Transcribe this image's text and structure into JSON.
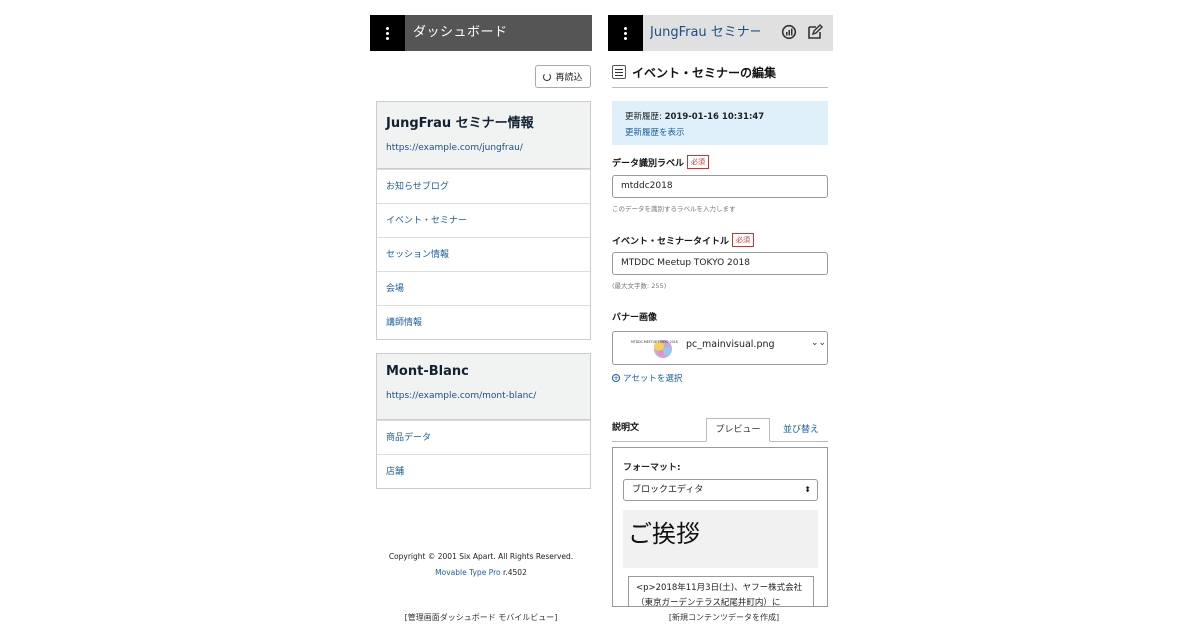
{
  "left": {
    "header_title": "ダッシュボード",
    "reload_label": "再読込",
    "sites": [
      {
        "name": "JungFrau セミナー情報",
        "url": "https://example.com/jungfrau/",
        "items": [
          "お知らせブログ",
          "イベント・セミナー",
          "セッション情報",
          "会場",
          "講師情報"
        ]
      },
      {
        "name": "Mont-Blanc",
        "url": "https://example.com/mont-blanc/",
        "items": [
          "商品データ",
          "店舗"
        ]
      }
    ],
    "footer_copyright": "Copyright © 2001 Six Apart. All Rights Reserved.",
    "footer_product": "Movable Type Pro",
    "footer_version": "r.4502",
    "caption": "[管理画面ダッシュボード モバイルビュー]"
  },
  "right": {
    "header_title": "JungFrau セミナー...",
    "page_title": "イベント・セミナーの編集",
    "history_label": "更新履歴:",
    "history_value": "2019-01-16 10:31:47",
    "history_link": "更新履歴を表示",
    "field_label1": "データ識別ラベル",
    "required_text": "必須",
    "field_value1": "mtddc2018",
    "field_hint1": "このデータを識別するラベルを入力します",
    "field_label2": "イベント・セミナータイトル",
    "field_value2": "MTDDC Meetup TOKYO 2018",
    "field_hint2": "(最大文字数: 255)",
    "banner_label": "バナー画像",
    "asset_thumb_text": "MTDDC MEETUP TOKYO 2018",
    "asset_filename": "pc_mainvisual.png",
    "select_asset": "アセットを選択",
    "desc_label": "説明文",
    "tab_preview": "プレビュー",
    "tab_sort": "並び替え",
    "format_label": "フォーマット:",
    "format_value": "ブロックエディタ",
    "heading_text": "ご挨拶",
    "html_content": "<p>2018年11月3日(土)、ヤフー株式会社（東京ガーデンテラス紀尾井町内）に",
    "caption": "[新規コンテンツデータを作成]"
  },
  "colors": {
    "left_header_bg": "#555555",
    "right_header_bg": "#e0e0e0",
    "link": "#1a5e9e",
    "info_bg": "#dff0fa",
    "required": "#cc3333"
  }
}
